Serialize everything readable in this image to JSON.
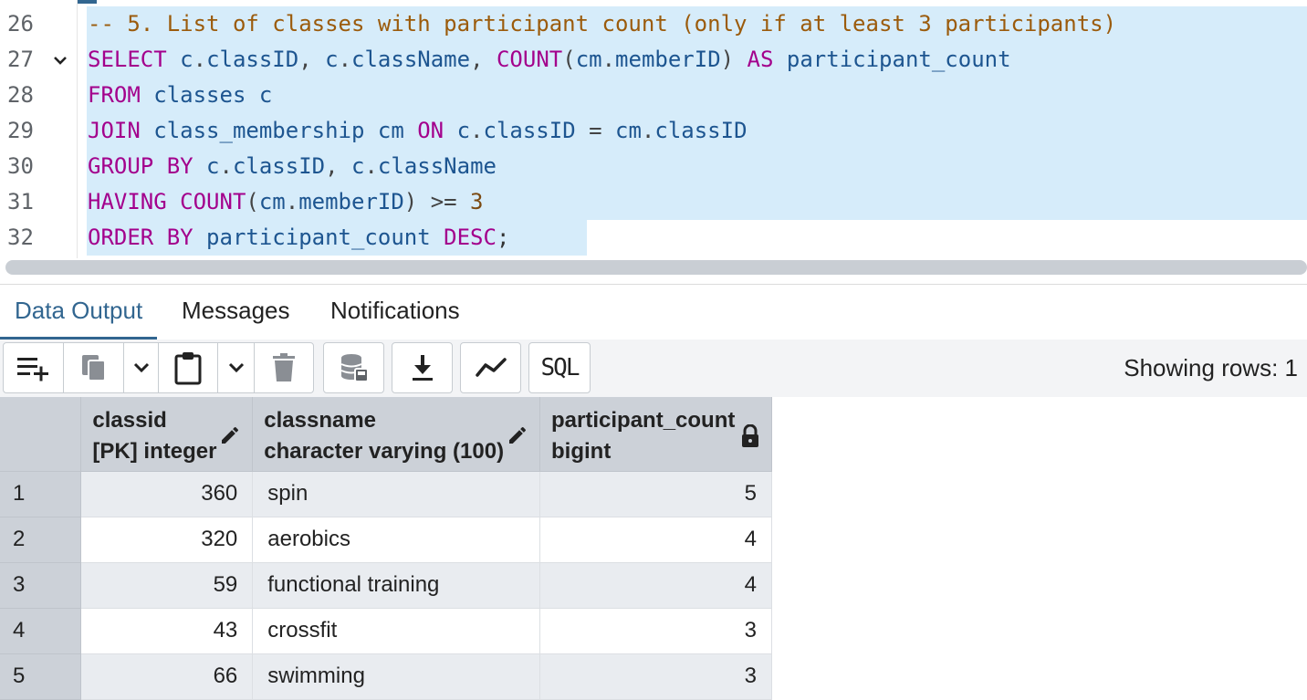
{
  "editor": {
    "lines": [
      {
        "n": "26",
        "fold": false,
        "tokens": [
          [
            "cm",
            "-- 5. List of classes with participant count (only if at least 3 participants)"
          ]
        ]
      },
      {
        "n": "27",
        "fold": true,
        "tokens": [
          [
            "kw",
            "SELECT"
          ],
          [
            "id",
            " c"
          ],
          [
            "op",
            "."
          ],
          [
            "id",
            "classID"
          ],
          [
            "op",
            ", "
          ],
          [
            "id",
            "c"
          ],
          [
            "op",
            "."
          ],
          [
            "id",
            "className"
          ],
          [
            "op",
            ", "
          ],
          [
            "kw",
            "COUNT"
          ],
          [
            "op",
            "("
          ],
          [
            "id",
            "cm"
          ],
          [
            "op",
            "."
          ],
          [
            "id",
            "memberID"
          ],
          [
            "op",
            ") "
          ],
          [
            "kw",
            "AS"
          ],
          [
            "id",
            " participant_count"
          ]
        ]
      },
      {
        "n": "28",
        "fold": false,
        "tokens": [
          [
            "kw",
            "FROM"
          ],
          [
            "id",
            " classes c"
          ]
        ]
      },
      {
        "n": "29",
        "fold": false,
        "tokens": [
          [
            "kw",
            "JOIN"
          ],
          [
            "id",
            " class_membership cm "
          ],
          [
            "kw",
            "ON"
          ],
          [
            "id",
            " c"
          ],
          [
            "op",
            "."
          ],
          [
            "id",
            "classID"
          ],
          [
            "op",
            " = "
          ],
          [
            "id",
            "cm"
          ],
          [
            "op",
            "."
          ],
          [
            "id",
            "classID"
          ]
        ]
      },
      {
        "n": "30",
        "fold": false,
        "tokens": [
          [
            "kw",
            "GROUP BY"
          ],
          [
            "id",
            " c"
          ],
          [
            "op",
            "."
          ],
          [
            "id",
            "classID"
          ],
          [
            "op",
            ", "
          ],
          [
            "id",
            "c"
          ],
          [
            "op",
            "."
          ],
          [
            "id",
            "className"
          ]
        ]
      },
      {
        "n": "31",
        "fold": false,
        "tokens": [
          [
            "kw",
            "HAVING COUNT"
          ],
          [
            "op",
            "("
          ],
          [
            "id",
            "cm"
          ],
          [
            "op",
            "."
          ],
          [
            "id",
            "memberID"
          ],
          [
            "op",
            ") >= "
          ],
          [
            "num",
            "3"
          ]
        ]
      },
      {
        "n": "32",
        "fold": false,
        "tokens": [
          [
            "kw",
            "ORDER BY"
          ],
          [
            "id",
            " participant_count "
          ],
          [
            "kw",
            "DESC"
          ],
          [
            "punct",
            ";"
          ]
        ]
      }
    ]
  },
  "tabs": [
    {
      "label": "Data Output",
      "active": true
    },
    {
      "label": "Messages",
      "active": false
    },
    {
      "label": "Notifications",
      "active": false
    }
  ],
  "toolbar": {
    "showing_rows": "Showing rows: 1",
    "buttons": [
      "add-row-icon",
      "copy-icon",
      "chevron-down-icon",
      "paste-icon",
      "chevron-down-icon",
      "delete-icon",
      "save-data-icon",
      "download-icon",
      "graph-icon",
      "sql-icon"
    ],
    "sql_label": "SQL"
  },
  "grid": {
    "columns": [
      {
        "name": "classid",
        "type": "[PK] integer",
        "icon": "pencil-icon"
      },
      {
        "name": "classname",
        "type": "character varying (100)",
        "icon": "pencil-icon"
      },
      {
        "name": "participant_count",
        "type": "bigint",
        "icon": "lock-icon"
      }
    ],
    "rows": [
      {
        "n": "1",
        "classid": "360",
        "classname": "spin",
        "participant_count": "5"
      },
      {
        "n": "2",
        "classid": "320",
        "classname": "aerobics",
        "participant_count": "4"
      },
      {
        "n": "3",
        "classid": "59",
        "classname": "functional training",
        "participant_count": "4"
      },
      {
        "n": "4",
        "classid": "43",
        "classname": "crossfit",
        "participant_count": "3"
      },
      {
        "n": "5",
        "classid": "66",
        "classname": "swimming",
        "participant_count": "3"
      }
    ]
  },
  "colors": {
    "accent": "#326690",
    "selection": "#d6ecfa",
    "header_bg": "#ccd1d8",
    "keyword": "#a3008c",
    "identifier": "#1d5590",
    "comment": "#9b5b0c"
  }
}
